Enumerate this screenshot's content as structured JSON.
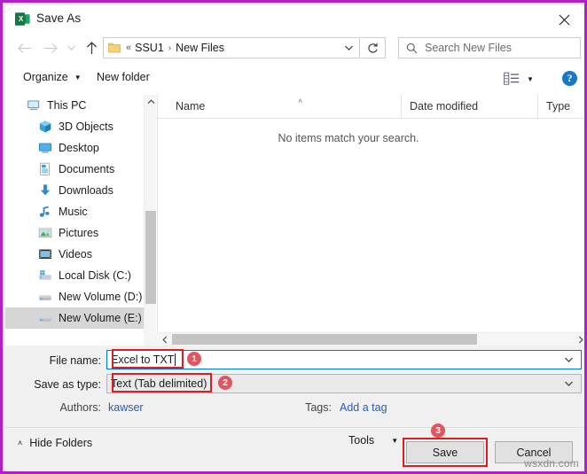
{
  "window": {
    "title": "Save As",
    "app_icon": "excel-icon",
    "close_label": "✕",
    "border_color": "#b020c8"
  },
  "nav": {
    "back_icon": "arrow-left-icon",
    "forward_icon": "arrow-right-icon",
    "recent_icon": "chevron-down-icon",
    "up_icon": "arrow-up-icon",
    "refresh_icon": "refresh-icon",
    "address": {
      "folder_icon": "folder-icon",
      "overflow": "«",
      "segments": [
        "SSU1",
        "New Files"
      ],
      "separator": "›",
      "dropdown_icon": "chevron-down-icon"
    },
    "search": {
      "icon": "search-icon",
      "placeholder": "Search New Files"
    }
  },
  "toolbar": {
    "organize_label": "Organize",
    "organize_caret": "▼",
    "new_folder_label": "New folder",
    "view_icon": "view-list-icon",
    "view_caret": "▼",
    "help_icon": "help-icon",
    "help_label": "?"
  },
  "sidebar": {
    "items": [
      {
        "label": "This PC",
        "icon": "this-pc-icon",
        "level": "root",
        "selected": false
      },
      {
        "label": "3D Objects",
        "icon": "3d-objects-icon",
        "level": "child",
        "selected": false
      },
      {
        "label": "Desktop",
        "icon": "desktop-icon",
        "level": "child",
        "selected": false
      },
      {
        "label": "Documents",
        "icon": "documents-icon",
        "level": "child",
        "selected": false
      },
      {
        "label": "Downloads",
        "icon": "downloads-icon",
        "level": "child",
        "selected": false
      },
      {
        "label": "Music",
        "icon": "music-icon",
        "level": "child",
        "selected": false
      },
      {
        "label": "Pictures",
        "icon": "pictures-icon",
        "level": "child",
        "selected": false
      },
      {
        "label": "Videos",
        "icon": "videos-icon",
        "level": "child",
        "selected": false
      },
      {
        "label": "Local Disk (C:)",
        "icon": "local-disk-icon",
        "level": "child",
        "selected": false
      },
      {
        "label": "New Volume (D:)",
        "icon": "drive-icon",
        "level": "child",
        "selected": false
      },
      {
        "label": "New Volume (E:)",
        "icon": "drive-icon",
        "level": "child",
        "selected": true
      }
    ],
    "scroll_up_icon": "chevron-up-icon",
    "scroll_down_icon": "chevron-down-icon"
  },
  "filelist": {
    "columns": [
      "Name",
      "Date modified",
      "Type"
    ],
    "sort_indicator": "˄",
    "rows": [],
    "empty_message": "No items match your search.",
    "hscroll_left_icon": "chevron-left-icon",
    "hscroll_right_icon": "chevron-right-icon"
  },
  "form": {
    "filename_label": "File name:",
    "filename_value": "Excel to TXT",
    "filename_dropdown_icon": "chevron-down-icon",
    "savetype_label": "Save as type:",
    "savetype_value": "Text (Tab delimited)",
    "savetype_dropdown_icon": "chevron-down-icon",
    "authors_label": "Authors:",
    "authors_value": "kawser",
    "tags_label": "Tags:",
    "tags_value": "Add a tag"
  },
  "footer": {
    "hide_folders_label": "Hide Folders",
    "hide_folders_caret": "˄",
    "tools_label": "Tools",
    "tools_caret": "▼",
    "save_label": "Save",
    "cancel_label": "Cancel"
  },
  "annotations": {
    "highlight_color": "#d81f26",
    "badge_color": "#e0555f",
    "badges": [
      {
        "number": "1",
        "target": "filename-input"
      },
      {
        "number": "2",
        "target": "savetype-input"
      },
      {
        "number": "3",
        "target": "save-button"
      }
    ]
  },
  "watermark": "wsxdn.com"
}
